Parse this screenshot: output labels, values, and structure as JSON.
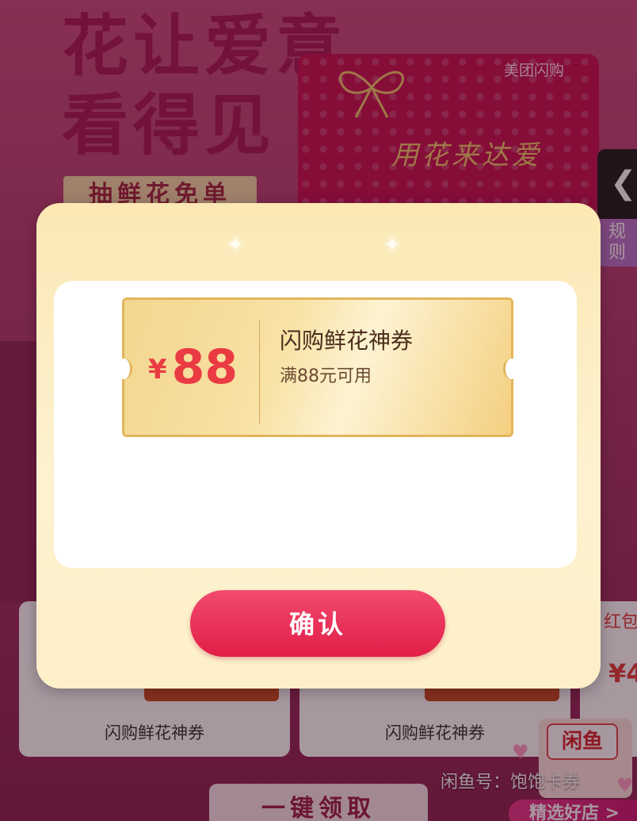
{
  "background": {
    "hero_title_line1": "花让爱意",
    "hero_title_line2": "看得见",
    "promo_tag": "抽鲜花免单",
    "gift_card": {
      "brand": "美团闪购",
      "script_text": "用花来达爱"
    },
    "side_back_icon": "chevron-left-icon",
    "side_rule_label": "规\n则",
    "cards": [
      {
        "label": "闪购鲜花神券"
      },
      {
        "label": "闪购鲜花神券"
      }
    ],
    "right_card": {
      "text_top": "红包",
      "text_price": "¥4"
    },
    "claim_all_label": "一键领取",
    "watermark": "闲鱼号：饱饱卡券",
    "fish_logo": "闲鱼",
    "shop_button": "精选好店 >"
  },
  "modal": {
    "coupon": {
      "currency": "¥",
      "amount": "88",
      "title": "闪购鲜花神券",
      "condition": "满88元可用"
    },
    "confirm_label": "确认"
  },
  "colors": {
    "accent_red": "#e11e48",
    "coupon_price": "#ea3b43",
    "modal_bg": "#fbe8b4"
  }
}
